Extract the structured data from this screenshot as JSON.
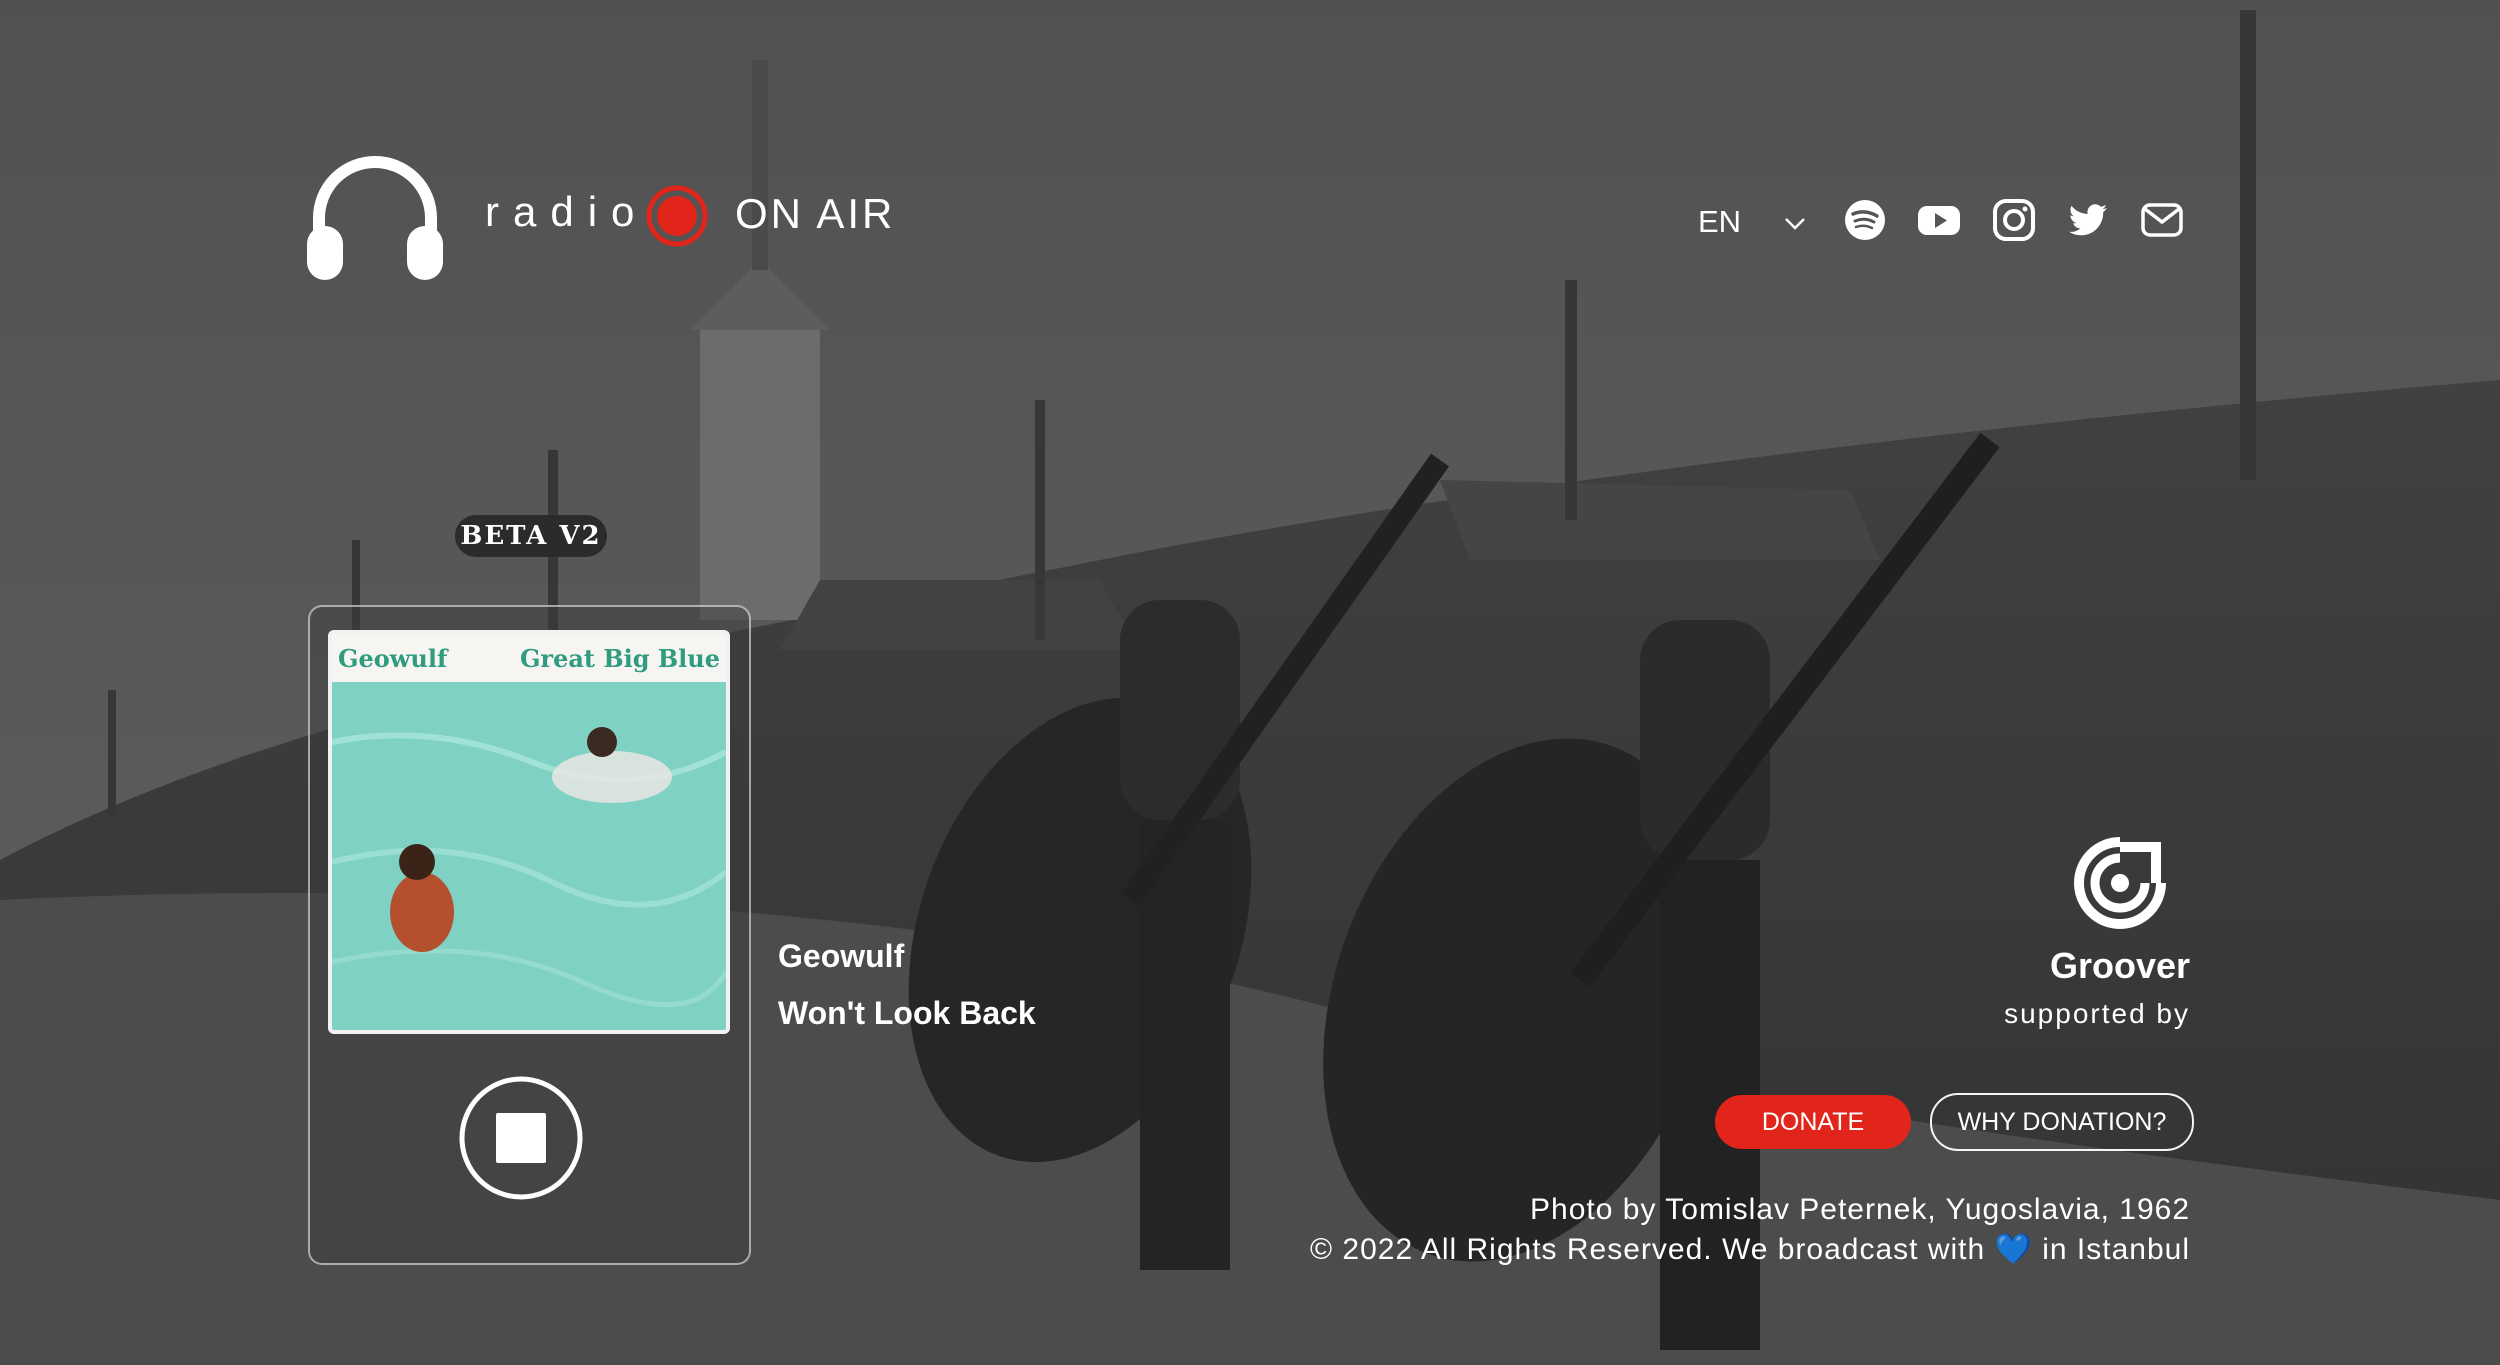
{
  "header": {
    "brand_word": "radio",
    "onair_label": "ON AIR",
    "language": "EN",
    "social_icons": [
      "spotify-icon",
      "youtube-icon",
      "instagram-icon",
      "twitter-icon",
      "mail-icon"
    ]
  },
  "badge": {
    "label": "BETA V2"
  },
  "player": {
    "cover_artist": "Geowulf",
    "cover_album": "Great Big Blue",
    "artist": "Geowulf",
    "track": "Won't Look Back",
    "control": "stop-icon"
  },
  "sponsor": {
    "name": "Groover",
    "caption": "supported by"
  },
  "donation": {
    "donate_label": "DONATE",
    "why_label": "WHY DONATION?"
  },
  "footer": {
    "credit": "Photo by Tomislav Peternek, Yugoslavia, 1962",
    "copyright_pre": "© 2022 All Rights Reserved. We broadcast with",
    "copyright_heart": "💙",
    "copyright_post": "in Istanbul"
  },
  "colors": {
    "accent": "#e1251b",
    "cover_text": "#2f9b7f",
    "pool": "#7fd1c4"
  }
}
